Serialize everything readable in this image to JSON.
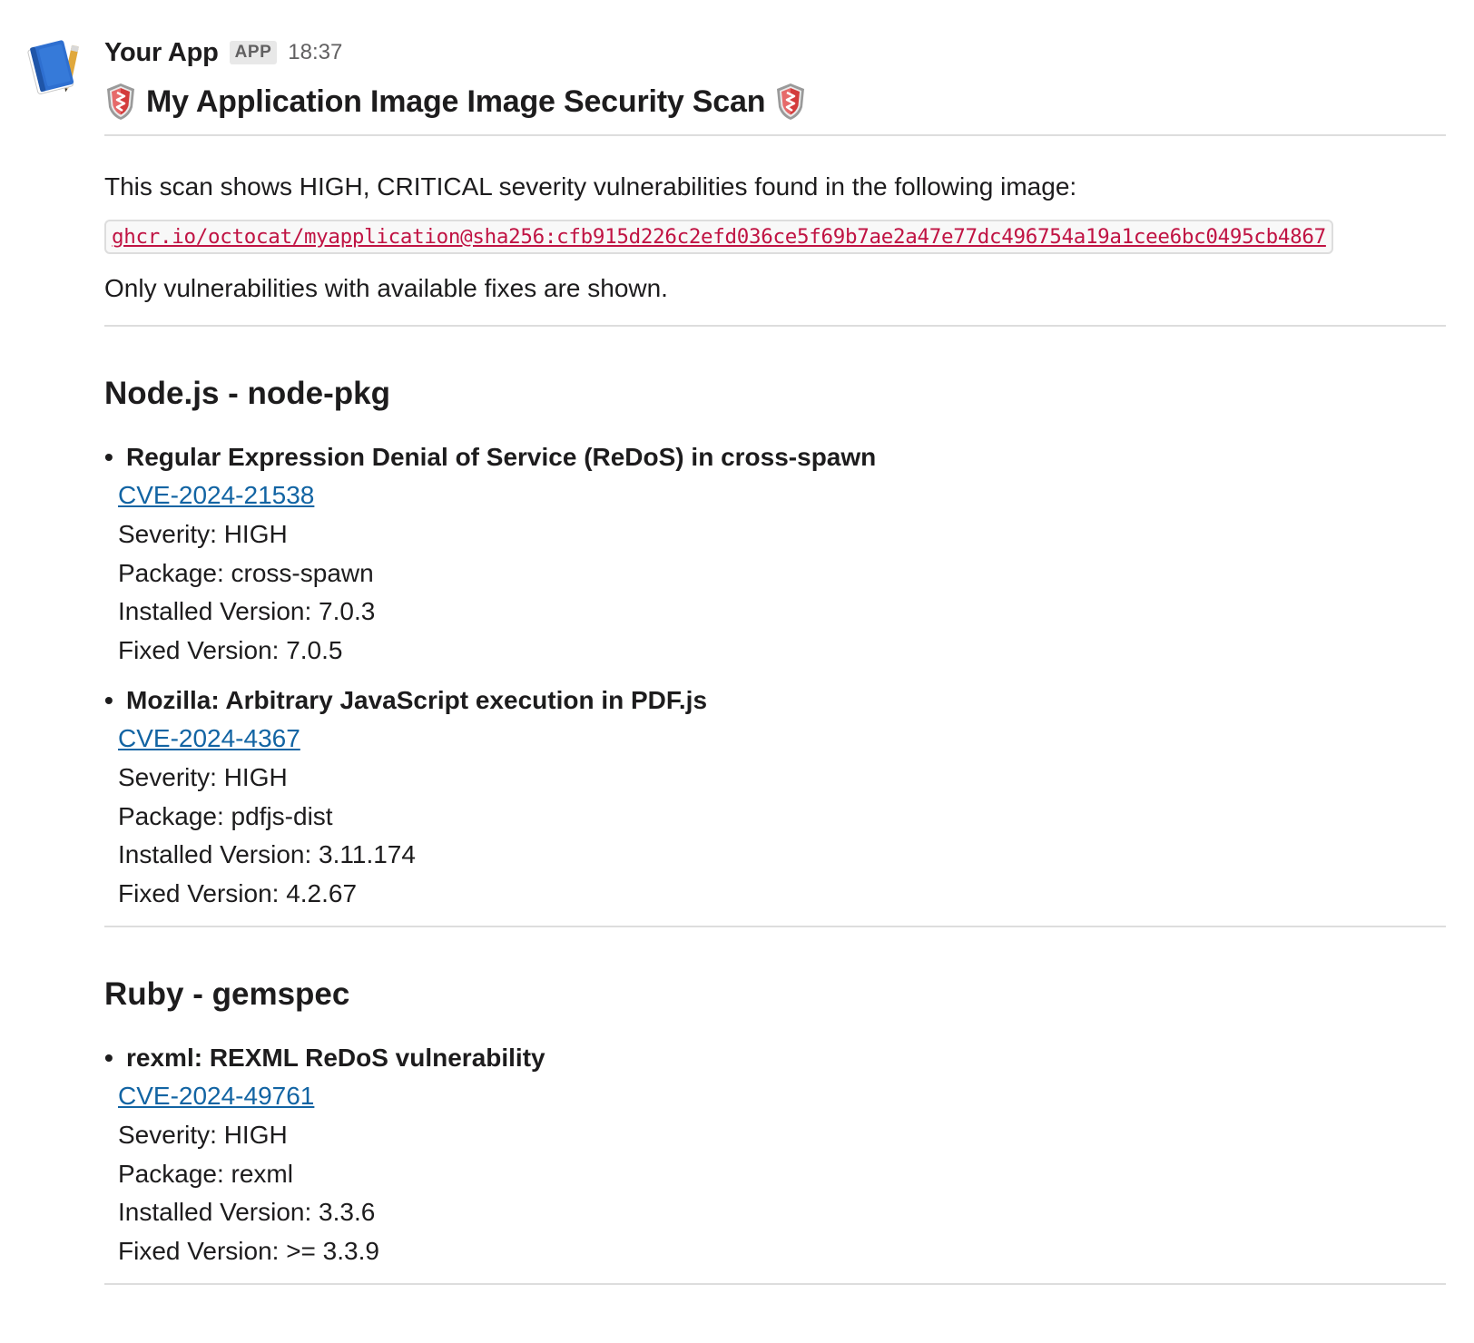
{
  "message": {
    "app_name": "Your App",
    "app_badge": "APP",
    "timestamp": "18:37",
    "avatar_icon": "blue-book-icon",
    "header": "My Application Image Image Security Scan",
    "header_icon": "shield-icon",
    "intro": "This scan shows HIGH, CRITICAL severity vulnerabilities found in the following image:",
    "image_ref": "ghcr.io/octocat/myapplication@sha256:cfb915d226c2efd036ce5f69b7ae2a47e77dc496754a19a1cee6bc0495cb4867",
    "note": "Only vulnerabilities with available fixes are shown."
  },
  "sections": [
    {
      "title": "Node.js - node-pkg",
      "vulnerabilities": [
        {
          "title": "Regular Expression Denial of Service (ReDoS) in cross-spawn",
          "cve": "CVE-2024-21538",
          "severity": "Severity: HIGH",
          "package": "Package: cross-spawn",
          "installed": "Installed Version: 7.0.3",
          "fixed": "Fixed Version: 7.0.5"
        },
        {
          "title": "Mozilla: Arbitrary JavaScript execution in PDF.js",
          "cve": "CVE-2024-4367",
          "severity": "Severity: HIGH",
          "package": "Package: pdfjs-dist",
          "installed": "Installed Version: 3.11.174",
          "fixed": "Fixed Version: 4.2.67"
        }
      ]
    },
    {
      "title": "Ruby - gemspec",
      "vulnerabilities": [
        {
          "title": "rexml: REXML ReDoS vulnerability",
          "cve": "CVE-2024-49761",
          "severity": "Severity: HIGH",
          "package": "Package: rexml",
          "installed": "Installed Version: 3.3.6",
          "fixed": "Fixed Version: >= 3.3.9"
        }
      ]
    }
  ],
  "colors": {
    "link": "#1264a3",
    "code": "#c01343",
    "divider": "#dddddd",
    "text": "#1d1c1d",
    "muted": "#616061"
  }
}
